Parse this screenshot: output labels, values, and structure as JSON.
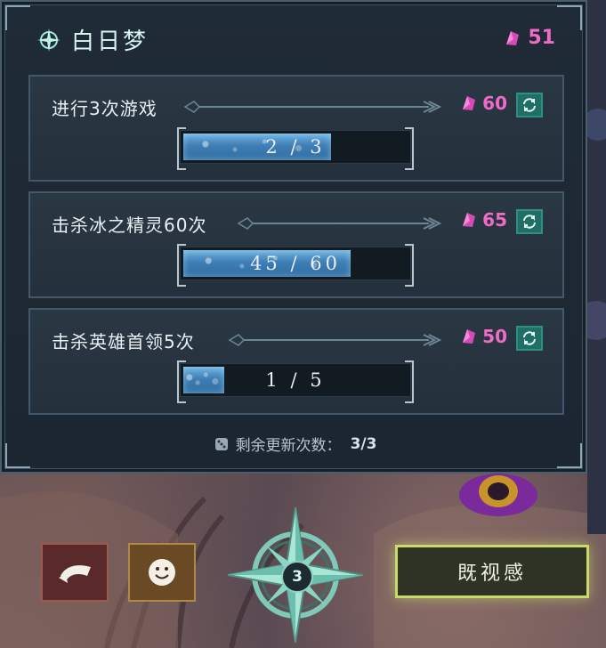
{
  "panel": {
    "title": "白日梦",
    "currency": "51"
  },
  "quests": [
    {
      "label": "进行3次游戏",
      "reward": "60",
      "progress_text": "2 / 3",
      "progress": 0.667
    },
    {
      "label": "击杀冰之精灵60次",
      "reward": "65",
      "progress_text": "45 / 60",
      "progress": 0.75
    },
    {
      "label": "击杀英雄首领5次",
      "reward": "50",
      "progress_text": "1 / 5",
      "progress": 0.2
    }
  ],
  "refresh": {
    "label": "剩余更新次数：",
    "value": "3/3"
  },
  "bottom": {
    "compass_count": "3",
    "deja_vu_label": "既视感"
  },
  "colors": {
    "currency": "#f06ac8",
    "accent": "#c9d96a",
    "refresh_button": "#1f6f66"
  },
  "icons": {
    "currency": "crystal-icon",
    "refresh": "refresh-icon",
    "gesture": "gesture-icon",
    "emote": "smiley-icon",
    "compass": "compass-star-icon",
    "dice": "dice-icon",
    "title": "compass-icon"
  }
}
